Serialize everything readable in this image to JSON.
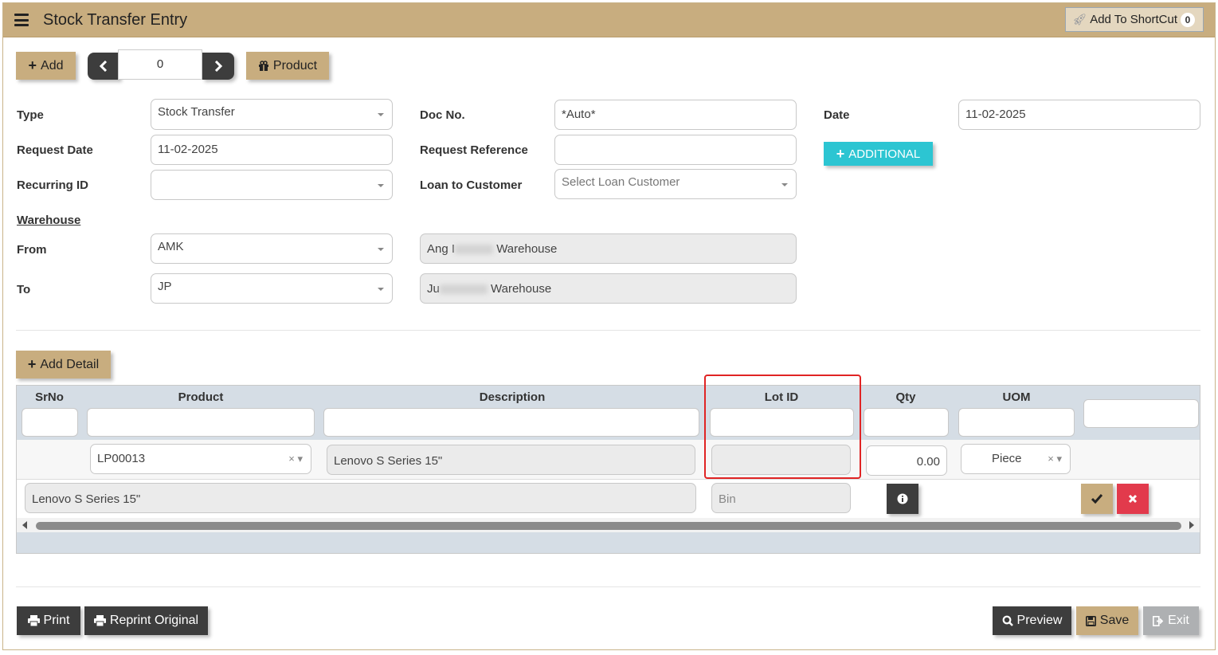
{
  "header": {
    "title": "Stock Transfer Entry",
    "shortcut_label": "Add To ShortCut",
    "shortcut_count": "0"
  },
  "toolbar": {
    "add_label": "Add",
    "nav_value": "0",
    "product_label": "Product"
  },
  "form": {
    "type_label": "Type",
    "type_value": "Stock Transfer",
    "docno_label": "Doc No.",
    "docno_value": "*Auto*",
    "date_label": "Date",
    "date_value": "11-02-2025",
    "reqdate_label": "Request Date",
    "reqdate_value": "11-02-2025",
    "reqref_label": "Request Reference",
    "reqref_value": "",
    "additional_label": "ADDITIONAL",
    "recurring_label": "Recurring ID",
    "recurring_value": "",
    "loan_label": "Loan to Customer",
    "loan_placeholder": "Select Loan Customer",
    "warehouse_label": "Warehouse",
    "from_label": "From",
    "from_value": "AMK",
    "from_name_prefix": "Ang I",
    "from_name_suffix": "Warehouse",
    "to_label": "To",
    "to_value": "JP",
    "to_name_prefix": "Ju",
    "to_name_suffix": "Warehouse"
  },
  "detail": {
    "add_detail_label": "Add Detail",
    "columns": [
      "SrNo",
      "Product",
      "Description",
      "Lot ID",
      "Qty",
      "UOM"
    ],
    "row": {
      "product": "LP00013",
      "description": "Lenovo S Series 15\"",
      "lot_id": "",
      "qty": "0.00",
      "uom": "Piece",
      "long_description": "Lenovo S Series 15\"",
      "bin_placeholder": "Bin"
    }
  },
  "footer": {
    "print_label": "Print",
    "reprint_label": "Reprint Original",
    "preview_label": "Preview",
    "save_label": "Save",
    "exit_label": "Exit"
  },
  "colors": {
    "tan": "#c8ad7f",
    "dark": "#3d3d3d",
    "teal": "#2cc5d2",
    "red": "#e23a4c",
    "highlight": "#e02424"
  }
}
